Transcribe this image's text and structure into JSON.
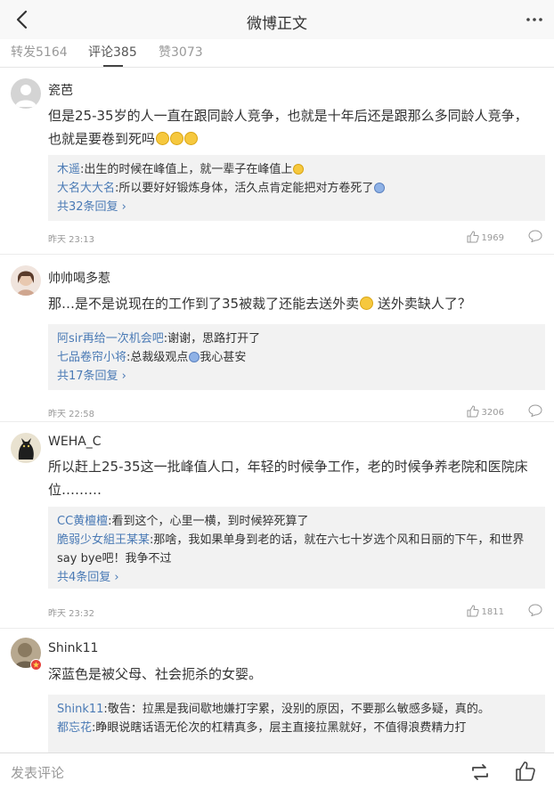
{
  "header": {
    "title": "微博正文",
    "back_icon": "chevron-left-icon",
    "more_icon": "ellipsis-icon"
  },
  "tabs": [
    {
      "label": "转发5164",
      "active": false
    },
    {
      "label": "评论385",
      "active": true
    },
    {
      "label": "赞3073",
      "active": false
    }
  ],
  "comments": [
    {
      "name": "瓷芭",
      "text_a": "但是25-35岁的人一直在跟同龄人竞争，也就是十年后还是跟那么多同龄人竞争，也就是要卷到死吗",
      "replies": [
        {
          "name": "木遥",
          "text": "出生的时候在峰值上，就一辈子在峰值上"
        },
        {
          "name": "大名大大名",
          "text": "所以要好好锻炼身体，活久点肯定能把对方卷死了"
        }
      ],
      "more": "共32条回复",
      "time": "昨天 23:13",
      "likes": "1969"
    },
    {
      "name": "帅帅喝多惹",
      "text_a": "那…是不是说现在的工作到了35被裁了还能去送外卖",
      "text_b": "送外卖缺人了？",
      "replies": [
        {
          "name": "阿sir再给一次机会吧",
          "text": "谢谢，思路打开了"
        },
        {
          "name": "七品卷帘小将",
          "text_a": "总裁级观点",
          "text_b": "我心甚安"
        }
      ],
      "more": "共17条回复",
      "time": "昨天 22:58",
      "likes": "3206"
    },
    {
      "name": "WEHA_C",
      "text_a": "所以赶上25-35这一批峰值人口，年轻的时候争工作，老的时候争养老院和医院床位………",
      "replies": [
        {
          "name": "CC黄檀檀",
          "text": "看到这个，心里一横，到时候猝死算了"
        },
        {
          "name": "脆弱少女組王某某",
          "text": "那啥，我如果单身到老的话，就在六七十岁选个风和日丽的下午，和世界say bye吧！我争不过"
        }
      ],
      "more": "共4条回复",
      "time": "昨天 23:32",
      "likes": "1811"
    },
    {
      "name": "Shink11",
      "text_a": "深蓝色是被父母、社会扼杀的女婴。",
      "replies": [
        {
          "name": "Shink11",
          "text": "敬告：拉黑是我间歇地嫌打字累，没别的原因，不要那么敏感多疑，真的。"
        },
        {
          "name": "都忘花",
          "text": "睁眼说瞎话语无伦次的杠精真多，层主直接拉黑就好，不值得浪费精力打"
        }
      ]
    }
  ],
  "bottom": {
    "placeholder": "发表评论",
    "repost_icon": "repost-icon",
    "like_icon": "thumbs-up-icon"
  },
  "colors": {
    "link": "#4a7ab5",
    "reply_bg": "#f2f2f2",
    "meta": "#999999"
  }
}
